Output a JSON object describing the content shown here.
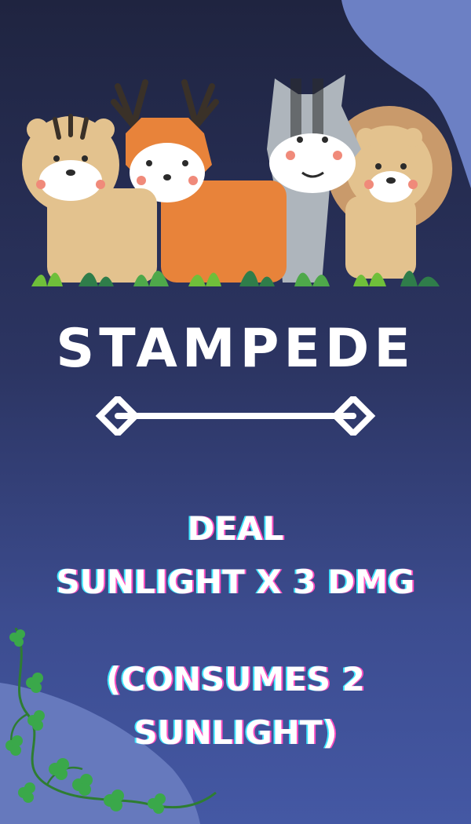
{
  "card": {
    "title": "STAMPEDE",
    "description_line1": "DEAL",
    "description_line2": "SUNLIGHT X 3 DMG",
    "cost_line1": "(CONSUMES 2",
    "cost_line2": "SUNLIGHT)"
  },
  "colors": {
    "background_top": "#1f2440",
    "background_bottom": "#4458a4",
    "accent_blob": "#6c80c4",
    "text": "#ffffff",
    "shadow_pink": "#ff4fbf",
    "shadow_cyan": "#3fe6ff"
  },
  "icons": [
    "tiger-icon",
    "deer-icon",
    "zebra-icon",
    "lion-icon",
    "diamond-divider-icon",
    "clover-vine-icon"
  ]
}
